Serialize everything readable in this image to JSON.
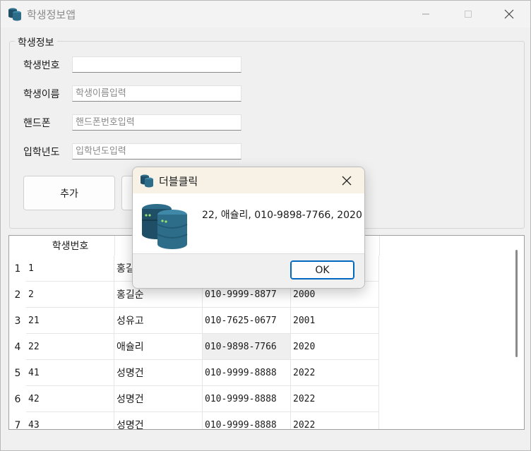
{
  "window": {
    "title": "학생정보앱"
  },
  "group": {
    "legend": "학생정보"
  },
  "form": {
    "fields": [
      {
        "label": "학생번호",
        "value": "",
        "placeholder": ""
      },
      {
        "label": "학생이름",
        "value": "",
        "placeholder": "학생이름입력"
      },
      {
        "label": "핸드폰",
        "value": "",
        "placeholder": "핸드폰번호입력"
      },
      {
        "label": "입학년도",
        "value": "",
        "placeholder": "입학년도입력"
      }
    ]
  },
  "buttons": {
    "add_label": "추가"
  },
  "grid": {
    "columns": [
      "학생번호"
    ],
    "rows": [
      {
        "row_header": "1",
        "cells": [
          "1",
          "홍길",
          "",
          ""
        ]
      },
      {
        "row_header": "2",
        "cells": [
          "2",
          "홍길순",
          "010-9999-8877",
          "2000"
        ]
      },
      {
        "row_header": "3",
        "cells": [
          "21",
          "성유고",
          "010-7625-0677",
          "2001"
        ]
      },
      {
        "row_header": "4",
        "cells": [
          "22",
          "애슐리",
          "010-9898-7766",
          "2020"
        ]
      },
      {
        "row_header": "5",
        "cells": [
          "41",
          "성명건",
          "010-9999-8888",
          "2022"
        ]
      },
      {
        "row_header": "6",
        "cells": [
          "42",
          "성명건",
          "010-9999-8888",
          "2022"
        ]
      },
      {
        "row_header": "7",
        "cells": [
          "43",
          "성명건",
          "010-9999-8888",
          "2022"
        ]
      }
    ]
  },
  "dialog": {
    "title": "더블클릭",
    "message": "22, 애슐리, 010-9898-7766, 2020",
    "ok_label": "OK"
  },
  "colors": {
    "accent": "#0067c0",
    "icon_dark": "#1f4f66",
    "icon_mid": "#2d6d8a",
    "icon_light": "#3f88a8",
    "dialog_title_bg": "#f7f1e6"
  }
}
